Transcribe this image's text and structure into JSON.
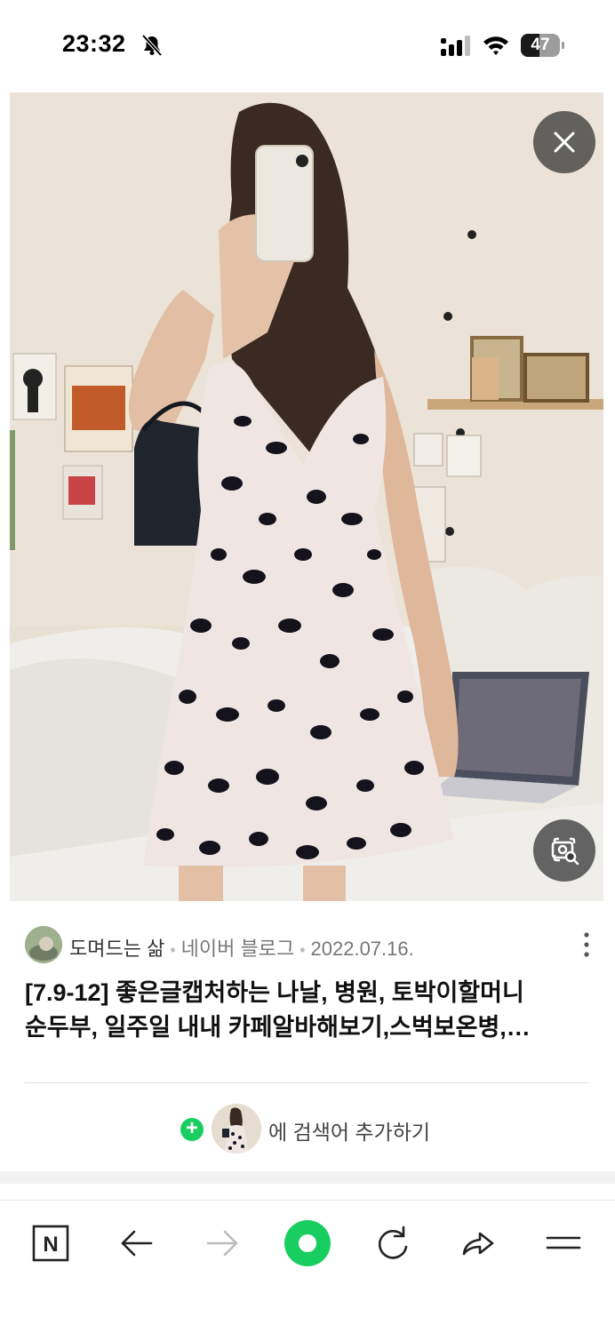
{
  "status_bar": {
    "time": "23:32",
    "battery_percent": "47",
    "battery_level": 0.47,
    "icons": [
      "bell-muted-icon",
      "signal-icon",
      "wifi-icon",
      "battery-icon"
    ]
  },
  "viewer": {
    "close_icon": "close-icon",
    "lens_icon": "image-search-icon"
  },
  "result": {
    "source_name": "도며드는 삶",
    "platform": "네이버 블로그",
    "date": "2022.07.16.",
    "title_line1": "[7.9-12] 좋은글캡처하는 나날, 병원, 토박이할머니",
    "title_line2": "순두부, 일주일 내내 카페알바해보기,스벅보온병,…",
    "more_icon": "more-vertical-icon"
  },
  "add_search": {
    "plus": "+",
    "text": "에 검색어 추가하기"
  },
  "toolbar": {
    "items": [
      "naver-home-icon",
      "back-arrow-icon",
      "forward-arrow-icon",
      "green-dot-icon",
      "refresh-icon",
      "share-icon",
      "menu-icon"
    ],
    "home_letter": "N"
  },
  "colors": {
    "naver_green": "#19ce60",
    "overlay_button": "#3c3c3c",
    "text_primary": "#111111",
    "text_secondary": "#777777"
  }
}
